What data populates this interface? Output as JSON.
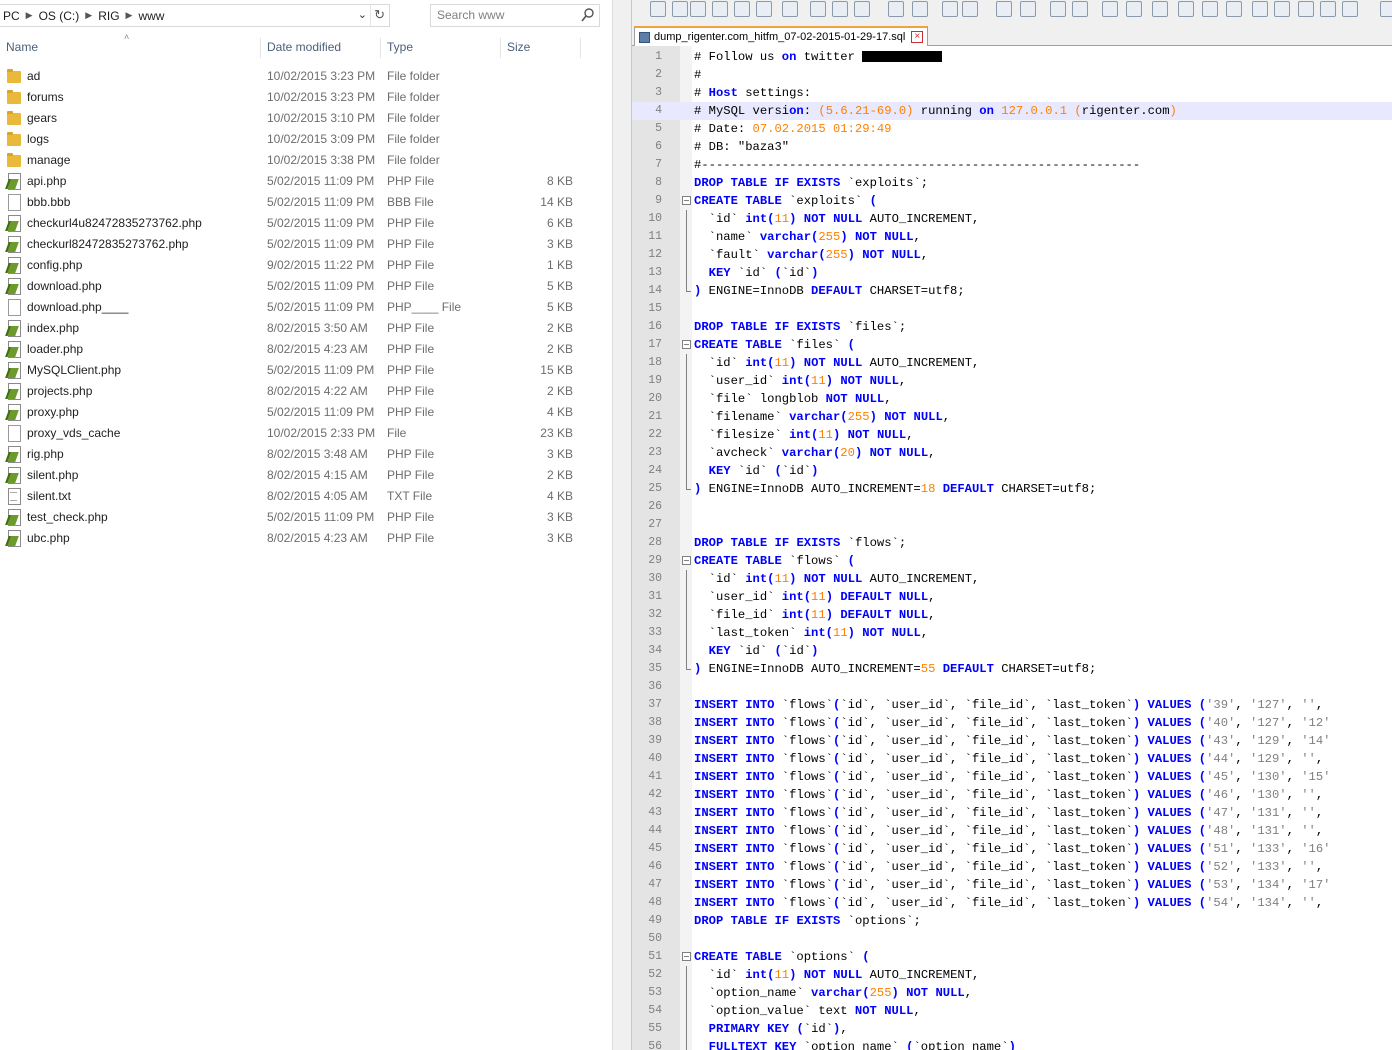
{
  "explorer": {
    "breadcrumbs": [
      "PC",
      "OS (C:)",
      "RIG",
      "www"
    ],
    "search_placeholder": "Search www",
    "columns": {
      "name": "Name",
      "date": "Date modified",
      "type": "Type",
      "size": "Size"
    },
    "files": [
      {
        "name": "ad",
        "date": "10/02/2015 3:23 PM",
        "type": "File folder",
        "size": "",
        "icon": "folder-icon"
      },
      {
        "name": "forums",
        "date": "10/02/2015 3:23 PM",
        "type": "File folder",
        "size": "",
        "icon": "folder-icon"
      },
      {
        "name": "gears",
        "date": "10/02/2015 3:10 PM",
        "type": "File folder",
        "size": "",
        "icon": "folder-icon"
      },
      {
        "name": "logs",
        "date": "10/02/2015 3:09 PM",
        "type": "File folder",
        "size": "",
        "icon": "folder-icon"
      },
      {
        "name": "manage",
        "date": "10/02/2015 3:38 PM",
        "type": "File folder",
        "size": "",
        "icon": "folder-icon"
      },
      {
        "name": "api.php",
        "date": "5/02/2015 11:09 PM",
        "type": "PHP File",
        "size": "8 KB",
        "icon": "php-file-icon"
      },
      {
        "name": "bbb.bbb",
        "date": "5/02/2015 11:09 PM",
        "type": "BBB File",
        "size": "14 KB",
        "icon": "file-icon"
      },
      {
        "name": "checkurl4u82472835273762.php",
        "date": "5/02/2015 11:09 PM",
        "type": "PHP File",
        "size": "6 KB",
        "icon": "php-file-icon"
      },
      {
        "name": "checkurl82472835273762.php",
        "date": "5/02/2015 11:09 PM",
        "type": "PHP File",
        "size": "3 KB",
        "icon": "php-file-icon"
      },
      {
        "name": "config.php",
        "date": "9/02/2015 11:22 PM",
        "type": "PHP File",
        "size": "1 KB",
        "icon": "php-file-icon"
      },
      {
        "name": "download.php",
        "date": "5/02/2015 11:09 PM",
        "type": "PHP File",
        "size": "5 KB",
        "icon": "php-file-icon"
      },
      {
        "name": "download.php____",
        "date": "5/02/2015 11:09 PM",
        "type": "PHP____ File",
        "size": "5 KB",
        "icon": "file-icon"
      },
      {
        "name": "index.php",
        "date": "8/02/2015 3:50 AM",
        "type": "PHP File",
        "size": "2 KB",
        "icon": "php-file-icon"
      },
      {
        "name": "loader.php",
        "date": "8/02/2015 4:23 AM",
        "type": "PHP File",
        "size": "2 KB",
        "icon": "php-file-icon"
      },
      {
        "name": "MySQLClient.php",
        "date": "5/02/2015 11:09 PM",
        "type": "PHP File",
        "size": "15 KB",
        "icon": "php-file-icon"
      },
      {
        "name": "projects.php",
        "date": "8/02/2015 4:22 AM",
        "type": "PHP File",
        "size": "2 KB",
        "icon": "php-file-icon"
      },
      {
        "name": "proxy.php",
        "date": "5/02/2015 11:09 PM",
        "type": "PHP File",
        "size": "4 KB",
        "icon": "php-file-icon"
      },
      {
        "name": "proxy_vds_cache",
        "date": "10/02/2015 2:33 PM",
        "type": "File",
        "size": "23 KB",
        "icon": "file-icon"
      },
      {
        "name": "rig.php",
        "date": "8/02/2015 3:48 AM",
        "type": "PHP File",
        "size": "3 KB",
        "icon": "php-file-icon"
      },
      {
        "name": "silent.php",
        "date": "8/02/2015 4:15 AM",
        "type": "PHP File",
        "size": "2 KB",
        "icon": "php-file-icon"
      },
      {
        "name": "silent.txt",
        "date": "8/02/2015 4:05 AM",
        "type": "TXT File",
        "size": "4 KB",
        "icon": "txt-file-icon"
      },
      {
        "name": "test_check.php",
        "date": "5/02/2015 11:09 PM",
        "type": "PHP File",
        "size": "3 KB",
        "icon": "php-file-icon"
      },
      {
        "name": "ubc.php",
        "date": "8/02/2015 4:23 AM",
        "type": "PHP File",
        "size": "3 KB",
        "icon": "php-file-icon"
      }
    ]
  },
  "editor": {
    "tab_title": "dump_rigenter.com_hitfm_07-02-2015-01-29-17.sql",
    "current_line": 4,
    "colors": {
      "keyword": "#0000ff",
      "number": "#ff8000",
      "comment": "#008000",
      "current_line": "#e8e8ff"
    },
    "lines": [
      {
        "n": 1,
        "text": "# Follow us on twitter "
      },
      {
        "n": 2,
        "text": "#"
      },
      {
        "n": 3,
        "text": "# Host settings:"
      },
      {
        "n": 4,
        "text": "# MySQL version: (5.6.21-69.0) running on 127.0.0.1 (rigenter.com)"
      },
      {
        "n": 5,
        "text": "# Date: 07.02.2015 01:29:49"
      },
      {
        "n": 6,
        "text": "# DB: \"baza3\""
      },
      {
        "n": 7,
        "text": "#------------------------------------------------------------"
      },
      {
        "n": 8,
        "text": "DROP TABLE IF EXISTS `exploits`;"
      },
      {
        "n": 9,
        "text": "CREATE TABLE `exploits` (",
        "fold": "box"
      },
      {
        "n": 10,
        "text": "  `id` int(11) NOT NULL AUTO_INCREMENT,",
        "fold": "line"
      },
      {
        "n": 11,
        "text": "  `name` varchar(255) NOT NULL,",
        "fold": "line"
      },
      {
        "n": 12,
        "text": "  `fault` varchar(255) NOT NULL,",
        "fold": "line"
      },
      {
        "n": 13,
        "text": "  KEY `id` (`id`)",
        "fold": "line"
      },
      {
        "n": 14,
        "text": ") ENGINE=InnoDB DEFAULT CHARSET=utf8;",
        "fold": "end"
      },
      {
        "n": 15,
        "text": ""
      },
      {
        "n": 16,
        "text": "DROP TABLE IF EXISTS `files`;"
      },
      {
        "n": 17,
        "text": "CREATE TABLE `files` (",
        "fold": "box"
      },
      {
        "n": 18,
        "text": "  `id` int(11) NOT NULL AUTO_INCREMENT,",
        "fold": "line"
      },
      {
        "n": 19,
        "text": "  `user_id` int(11) NOT NULL,",
        "fold": "line"
      },
      {
        "n": 20,
        "text": "  `file` longblob NOT NULL,",
        "fold": "line"
      },
      {
        "n": 21,
        "text": "  `filename` varchar(255) NOT NULL,",
        "fold": "line"
      },
      {
        "n": 22,
        "text": "  `filesize` int(11) NOT NULL,",
        "fold": "line"
      },
      {
        "n": 23,
        "text": "  `avcheck` varchar(20) NOT NULL,",
        "fold": "line"
      },
      {
        "n": 24,
        "text": "  KEY `id` (`id`)",
        "fold": "line"
      },
      {
        "n": 25,
        "text": ") ENGINE=InnoDB AUTO_INCREMENT=18 DEFAULT CHARSET=utf8;",
        "fold": "end"
      },
      {
        "n": 26,
        "text": ""
      },
      {
        "n": 27,
        "text": ""
      },
      {
        "n": 28,
        "text": "DROP TABLE IF EXISTS `flows`;"
      },
      {
        "n": 29,
        "text": "CREATE TABLE `flows` (",
        "fold": "box"
      },
      {
        "n": 30,
        "text": "  `id` int(11) NOT NULL AUTO_INCREMENT,",
        "fold": "line"
      },
      {
        "n": 31,
        "text": "  `user_id` int(11) DEFAULT NULL,",
        "fold": "line"
      },
      {
        "n": 32,
        "text": "  `file_id` int(11) DEFAULT NULL,",
        "fold": "line"
      },
      {
        "n": 33,
        "text": "  `last_token` int(11) NOT NULL,",
        "fold": "line"
      },
      {
        "n": 34,
        "text": "  KEY `id` (`id`)",
        "fold": "line"
      },
      {
        "n": 35,
        "text": ") ENGINE=InnoDB AUTO_INCREMENT=55 DEFAULT CHARSET=utf8;",
        "fold": "end"
      },
      {
        "n": 36,
        "text": ""
      },
      {
        "n": 37,
        "text": "INSERT INTO `flows`(`id`, `user_id`, `file_id`, `last_token`) VALUES ('39', '127', '',"
      },
      {
        "n": 38,
        "text": "INSERT INTO `flows`(`id`, `user_id`, `file_id`, `last_token`) VALUES ('40', '127', '12'"
      },
      {
        "n": 39,
        "text": "INSERT INTO `flows`(`id`, `user_id`, `file_id`, `last_token`) VALUES ('43', '129', '14'"
      },
      {
        "n": 40,
        "text": "INSERT INTO `flows`(`id`, `user_id`, `file_id`, `last_token`) VALUES ('44', '129', '',"
      },
      {
        "n": 41,
        "text": "INSERT INTO `flows`(`id`, `user_id`, `file_id`, `last_token`) VALUES ('45', '130', '15'"
      },
      {
        "n": 42,
        "text": "INSERT INTO `flows`(`id`, `user_id`, `file_id`, `last_token`) VALUES ('46', '130', '',"
      },
      {
        "n": 43,
        "text": "INSERT INTO `flows`(`id`, `user_id`, `file_id`, `last_token`) VALUES ('47', '131', '',"
      },
      {
        "n": 44,
        "text": "INSERT INTO `flows`(`id`, `user_id`, `file_id`, `last_token`) VALUES ('48', '131', '',"
      },
      {
        "n": 45,
        "text": "INSERT INTO `flows`(`id`, `user_id`, `file_id`, `last_token`) VALUES ('51', '133', '16'"
      },
      {
        "n": 46,
        "text": "INSERT INTO `flows`(`id`, `user_id`, `file_id`, `last_token`) VALUES ('52', '133', '',"
      },
      {
        "n": 47,
        "text": "INSERT INTO `flows`(`id`, `user_id`, `file_id`, `last_token`) VALUES ('53', '134', '17'"
      },
      {
        "n": 48,
        "text": "INSERT INTO `flows`(`id`, `user_id`, `file_id`, `last_token`) VALUES ('54', '134', '',"
      },
      {
        "n": 49,
        "text": "DROP TABLE IF EXISTS `options`;"
      },
      {
        "n": 50,
        "text": ""
      },
      {
        "n": 51,
        "text": "CREATE TABLE `options` (",
        "fold": "box"
      },
      {
        "n": 52,
        "text": "  `id` int(11) NOT NULL AUTO_INCREMENT,",
        "fold": "line"
      },
      {
        "n": 53,
        "text": "  `option_name` varchar(255) NOT NULL,",
        "fold": "line"
      },
      {
        "n": 54,
        "text": "  `option_value` text NOT NULL,",
        "fold": "line"
      },
      {
        "n": 55,
        "text": "  PRIMARY KEY (`id`),",
        "fold": "line"
      },
      {
        "n": 56,
        "text": "  FULLTEXT KEY `option_name` (`option_name`)",
        "fold": "line"
      }
    ]
  }
}
